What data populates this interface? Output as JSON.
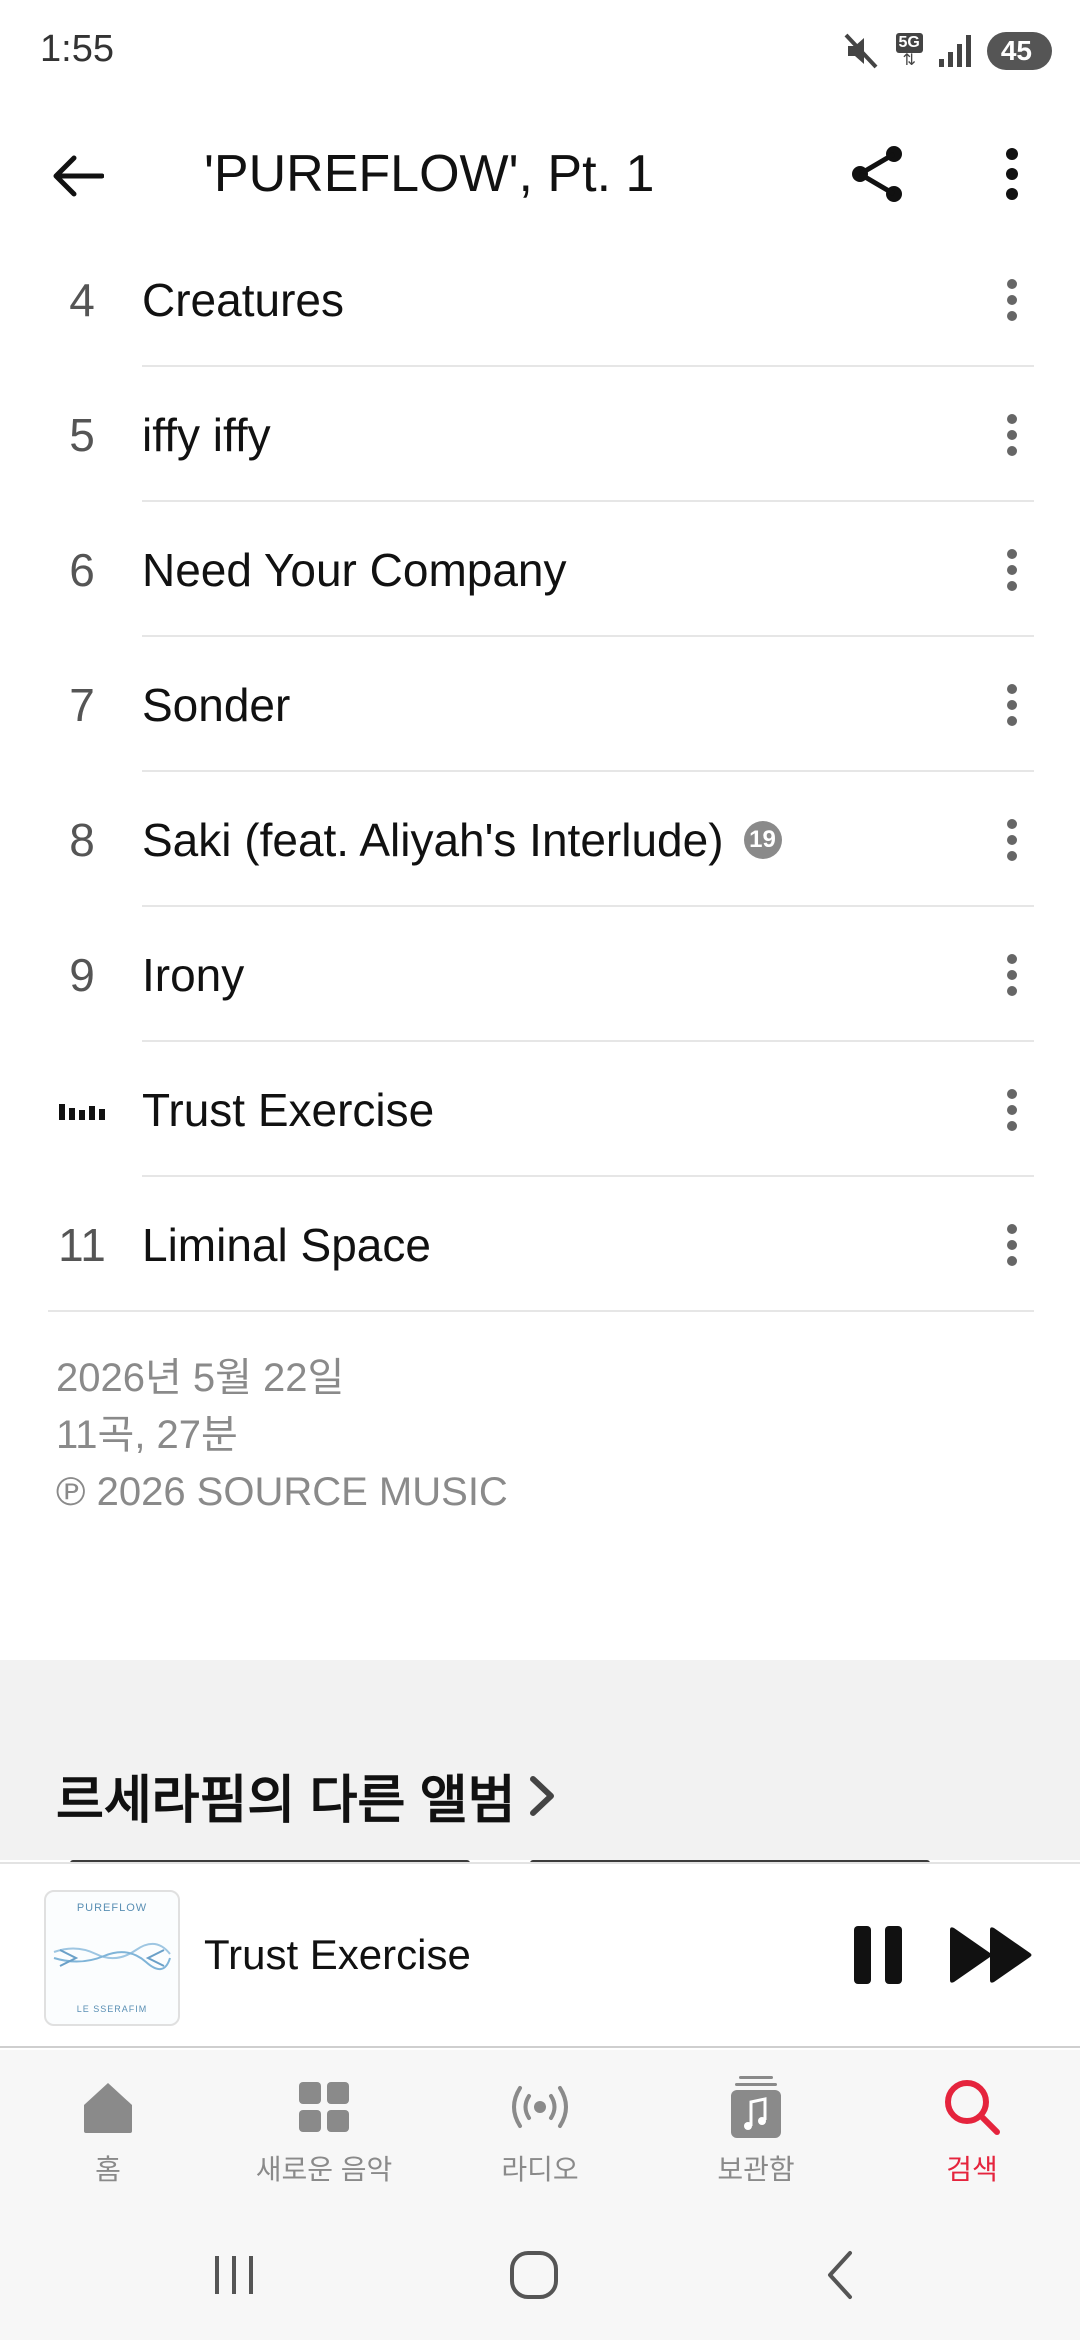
{
  "status_bar": {
    "time": "1:55",
    "network": "5G",
    "battery": "45"
  },
  "header": {
    "title": "'PUREFLOW', Pt. 1"
  },
  "tracks": [
    {
      "number": "4",
      "title": "Creatures",
      "explicit": false
    },
    {
      "number": "5",
      "title": "iffy iffy",
      "explicit": false
    },
    {
      "number": "6",
      "title": "Need Your Company",
      "explicit": false
    },
    {
      "number": "7",
      "title": "Sonder",
      "explicit": false
    },
    {
      "number": "8",
      "title": "Saki (feat. Aliyah's Interlude)",
      "explicit": true,
      "badge": "19"
    },
    {
      "number": "9",
      "title": "Irony",
      "explicit": false
    },
    {
      "number": "",
      "title": "Trust Exercise",
      "explicit": false,
      "now_playing": true
    },
    {
      "number": "11",
      "title": "Liminal Space",
      "explicit": false
    }
  ],
  "album_info": {
    "release_date": "2026년 5월 22일",
    "track_count_duration": "11곡, 27분",
    "copyright": "℗ 2026 SOURCE MUSIC"
  },
  "other_albums": {
    "title": "르세라핌의 다른 앨범"
  },
  "mini_player": {
    "title": "Trust Exercise",
    "art_top_text": "PUREFLOW",
    "art_bottom_text": "LE SSERAFIM"
  },
  "tabs": [
    {
      "label": "홈",
      "icon": "home-icon"
    },
    {
      "label": "새로운 음악",
      "icon": "grid-icon"
    },
    {
      "label": "라디오",
      "icon": "radio-icon"
    },
    {
      "label": "보관함",
      "icon": "library-icon"
    },
    {
      "label": "검색",
      "icon": "search-icon",
      "active": true
    }
  ],
  "colors": {
    "accent": "#e5243d",
    "secondary_text": "#8a8a8a",
    "section_bg": "#f2f2f2"
  }
}
